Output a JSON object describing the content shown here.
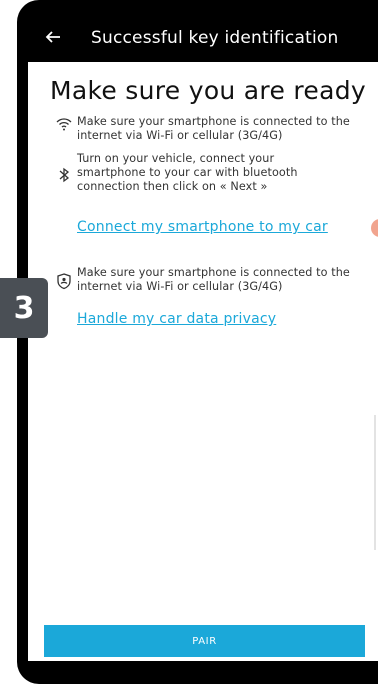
{
  "header": {
    "back_icon": "arrow-left-icon",
    "title": "Successful key identification"
  },
  "main": {
    "heading": "Make sure you are ready",
    "items": [
      {
        "icon": "wifi-icon",
        "text": "Make sure your smartphone is connected to the internet via Wi-Fi or cellular (3G/4G)"
      },
      {
        "icon": "bluetooth-icon",
        "text": "Turn on your vehicle, connect your smartphone to your car with bluetooth connection then click on « Next »"
      },
      {
        "icon": "shield-user-icon",
        "text": "Make sure your smartphone is connected to the internet via Wi-Fi or cellular (3G/4G)"
      }
    ],
    "link_connect": "Connect my smartphone to my car",
    "link_privacy": "Handle my car data privacy"
  },
  "step_badge": "3",
  "pair_button": {
    "label": "PAIR"
  },
  "colors": {
    "accent": "#1ba8d9",
    "badge": "#4a4f55",
    "frame": "#000000"
  }
}
